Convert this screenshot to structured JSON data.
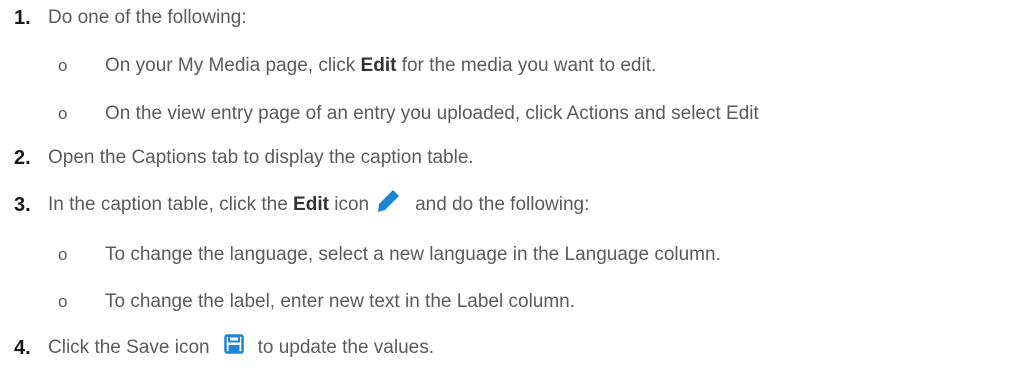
{
  "steps": [
    {
      "number": "1.",
      "text": "Do one of the following:"
    },
    {
      "number": "2.",
      "text": "Open the Captions tab to display the caption table."
    },
    {
      "number": "3.",
      "text_before": "In the caption table, click the ",
      "bold": "Edit",
      "text_mid": " icon",
      "text_after": "and do the following:"
    },
    {
      "number": "4.",
      "text_before": "Click the Save icon",
      "text_after": "to update the values."
    }
  ],
  "step1_sub": [
    {
      "bullet": "o",
      "text_before": "On your My Media page, click ",
      "bold": "Edit",
      "text_after": " for the media you want to edit."
    },
    {
      "bullet": "o",
      "text": "On the view entry page of an entry you uploaded, click Actions and select Edit"
    }
  ],
  "step3_sub": [
    {
      "bullet": "o",
      "text": "To change the language, select a new language in the Language column."
    },
    {
      "bullet": "o",
      "text": "To change the label, enter new text in the Label column."
    }
  ],
  "icons": {
    "edit": "pencil-icon",
    "save": "floppy-disk-icon",
    "edit_color": "#1c86d6",
    "save_color": "#1c86d6"
  }
}
